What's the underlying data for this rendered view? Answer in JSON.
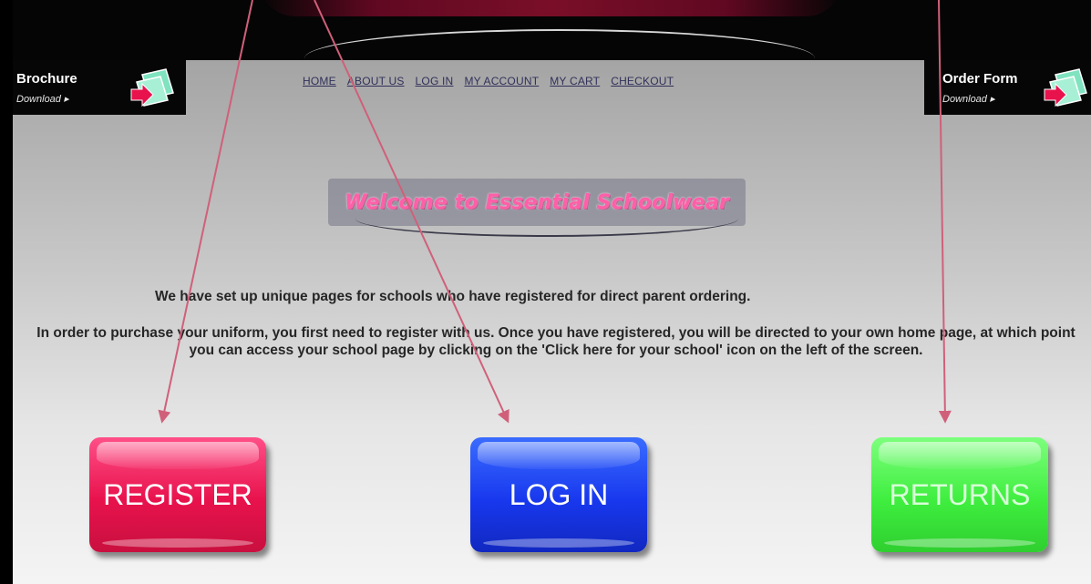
{
  "header": {
    "brochure": {
      "title": "Brochure",
      "sub": "Download ▸"
    },
    "order_form": {
      "title": "Order Form",
      "sub": "Download ▸"
    }
  },
  "nav": {
    "items": [
      "HOME",
      "ABOUT US",
      "LOG IN",
      "MY ACCOUNT",
      "MY CART",
      "CHECKOUT"
    ]
  },
  "banner": {
    "text": "Welcome to Essential Schoolwear"
  },
  "intro": {
    "line1": "We have set up unique pages for schools who have registered for direct parent ordering.",
    "line2": "In order to purchase your uniform, you first need to register with us. Once you have registered, you will be directed to your own home page, at which point you can access your school page by clicking on the 'Click here for your school' icon on the left of the screen."
  },
  "buttons": {
    "register": "REGISTER",
    "login": "LOG IN",
    "returns": "RETURNS"
  },
  "colors": {
    "register": "#e8124c",
    "login": "#1838ee",
    "returns": "#3fee3f",
    "annotation_arrow": "#d0607a",
    "banner_text": "#ff5fa8"
  }
}
